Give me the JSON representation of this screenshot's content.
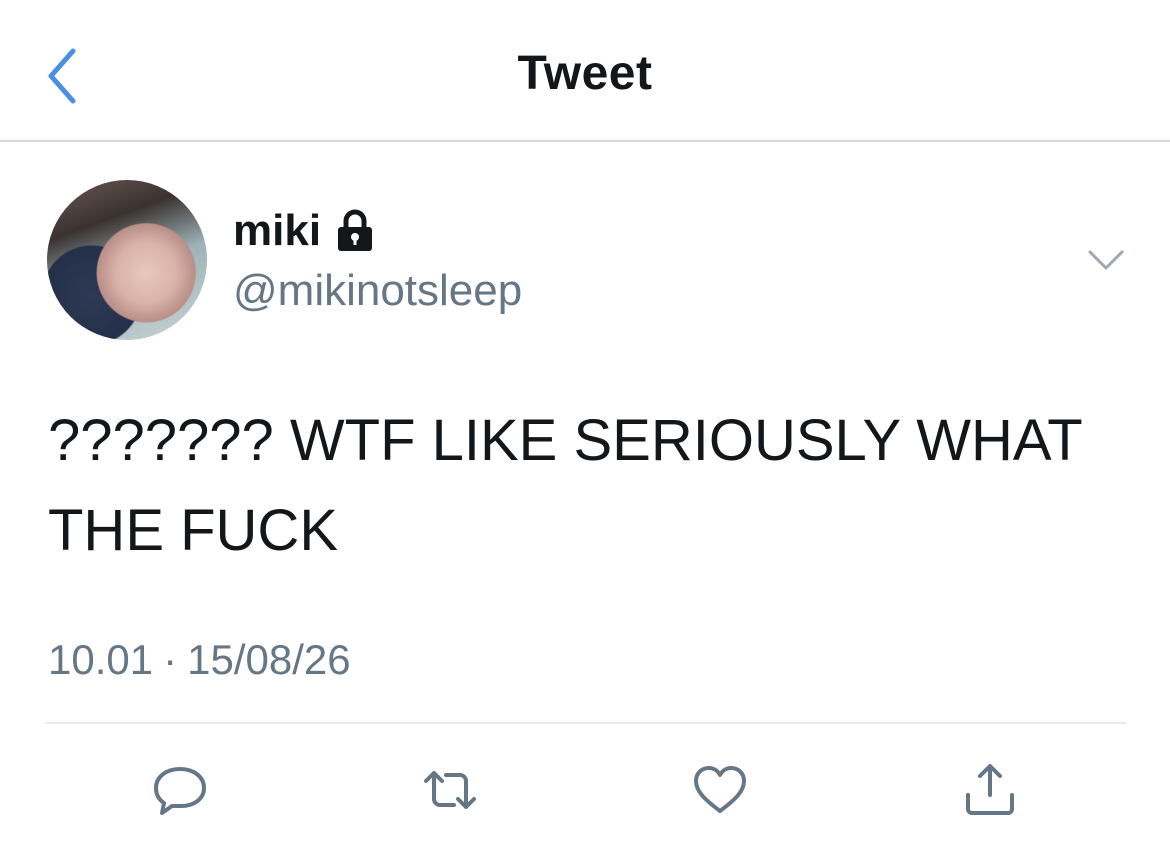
{
  "header": {
    "title": "Tweet",
    "back_icon": "chevron-left-icon"
  },
  "tweet": {
    "display_name": "miki",
    "protected_icon": "lock-icon",
    "handle": "@mikinotsleep",
    "text": "??????? WTF LIKE SERIOUSLY WHAT THE FUCK",
    "time": "10.01",
    "separator": "·",
    "date": "15/08/26"
  },
  "actions": [
    {
      "icon": "reply-icon"
    },
    {
      "icon": "retweet-icon"
    },
    {
      "icon": "heart-icon"
    },
    {
      "icon": "share-icon"
    }
  ],
  "colors": {
    "accent": "#1da1f2",
    "back": "#4a90e2",
    "secondary_text": "#657786",
    "icon": "#657786"
  }
}
